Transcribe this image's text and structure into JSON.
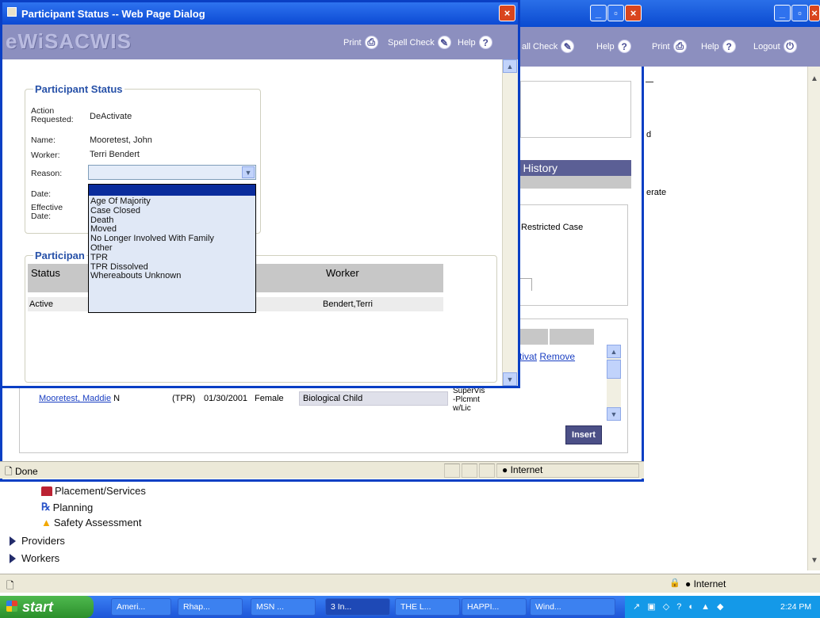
{
  "outer_window": {
    "banner_links": {
      "print": "Print",
      "help": "Help",
      "logout": "Logout"
    },
    "side_text": {
      "d": "d",
      "erate": "erate"
    },
    "status": {
      "zone": "Internet"
    }
  },
  "tree": {
    "items": [
      {
        "label": "Placement/Services"
      },
      {
        "label": "Planning"
      },
      {
        "label": "Safety Assessment"
      }
    ],
    "groups": [
      {
        "label": "Providers"
      },
      {
        "label": "Workers"
      }
    ]
  },
  "middle_window": {
    "banner_links": {
      "spell_check_partial": "all Check",
      "help": "Help"
    },
    "tab_title": "ng History",
    "restricted_case": "Restricted Case",
    "table_links": {
      "activate": "ctivat",
      "remove": "Remove"
    },
    "row": {
      "name": "Mooretest, Maddie",
      "flag": "N",
      "status": "(TPR)",
      "dob": "01/30/2001",
      "gender": "Female",
      "relationship": "Biological Child",
      "type_lines": [
        "SuperVis",
        "-Plcmnt",
        "w/Lic"
      ]
    },
    "insert_button": "Insert",
    "status": {
      "done": "Done",
      "zone": "Internet"
    }
  },
  "dialog": {
    "title": "Participant Status -- Web Page Dialog",
    "logo": "eWiSACWIS",
    "banner_links": {
      "print": "Print",
      "spell_check": "Spell Check",
      "help": "Help"
    },
    "status_section": {
      "legend": "Participant Status",
      "fields": {
        "action_requested_label_1": "Action",
        "action_requested_label_2": "Requested:",
        "action_requested_value": "DeActivate",
        "name_label": "Name:",
        "name_value": "Mooretest, John",
        "worker_label": "Worker:",
        "worker_value": "Terri Bendert",
        "reason_label": "Reason:",
        "reason_value": "",
        "date_label": "Date:",
        "effective_date_label_1": "Effective",
        "effective_date_label_2": "Date:"
      }
    },
    "reason_options": [
      "",
      "Age Of Majority",
      "Case Closed",
      "Death",
      "Moved",
      "No Longer Involved With Family",
      "Other",
      "TPR",
      "TPR Dissolved",
      "Whereabouts Unknown"
    ],
    "history_section": {
      "legend_partial": "Participan",
      "columns": {
        "status": "Status",
        "worker": "Worker"
      },
      "rows": [
        {
          "status": "Active",
          "worker": "Bendert,Terri"
        }
      ]
    }
  },
  "taskbar": {
    "start": "start",
    "tasks": [
      "Ameri...",
      "Rhap...",
      "MSN ...",
      "3 In...",
      "THE L...",
      "HAPPI...",
      "Wind..."
    ],
    "clock": "2:24 PM"
  },
  "colors": {
    "banner": "#8c8fbf",
    "titlebar": "#0a4ad0",
    "section_legend": "#2751a8",
    "link": "#1a3fc2",
    "dropdown_selected": "#0a2c9c"
  }
}
